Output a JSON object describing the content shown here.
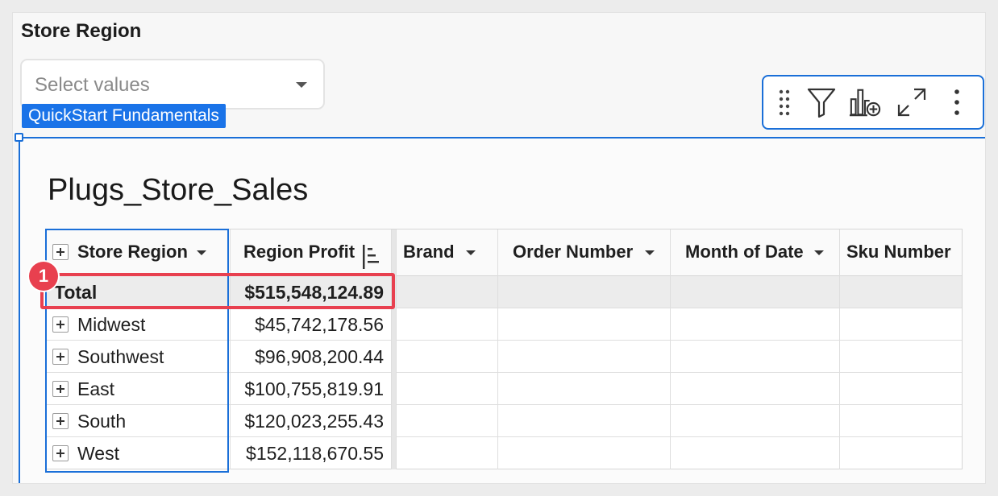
{
  "control": {
    "title": "Store Region",
    "placeholder": "Select values",
    "tag": "QuickStart Fundamentals"
  },
  "toolbar": {
    "icons": [
      "drag-handle-icon",
      "filter-icon",
      "add-chart-icon",
      "expand-icon",
      "more-vert-icon"
    ]
  },
  "table": {
    "title": "Plugs_Store_Sales",
    "columns": [
      "Store Region",
      "Region Profit",
      "Brand",
      "Order Number",
      "Month of Date",
      "Sku Number"
    ],
    "total": {
      "label": "Total",
      "profit": "$515,548,124.89"
    },
    "rows": [
      {
        "region": "Midwest",
        "profit": "$45,742,178.56"
      },
      {
        "region": "Southwest",
        "profit": "$96,908,200.44"
      },
      {
        "region": "East",
        "profit": "$100,755,819.91"
      },
      {
        "region": "South",
        "profit": "$120,023,255.43"
      },
      {
        "region": "West",
        "profit": "$152,118,670.55"
      }
    ]
  },
  "annotation": {
    "badge": "1",
    "color": "#e8404f"
  },
  "colors": {
    "accent": "#1a73e8",
    "selection": "#1a6fd8"
  }
}
